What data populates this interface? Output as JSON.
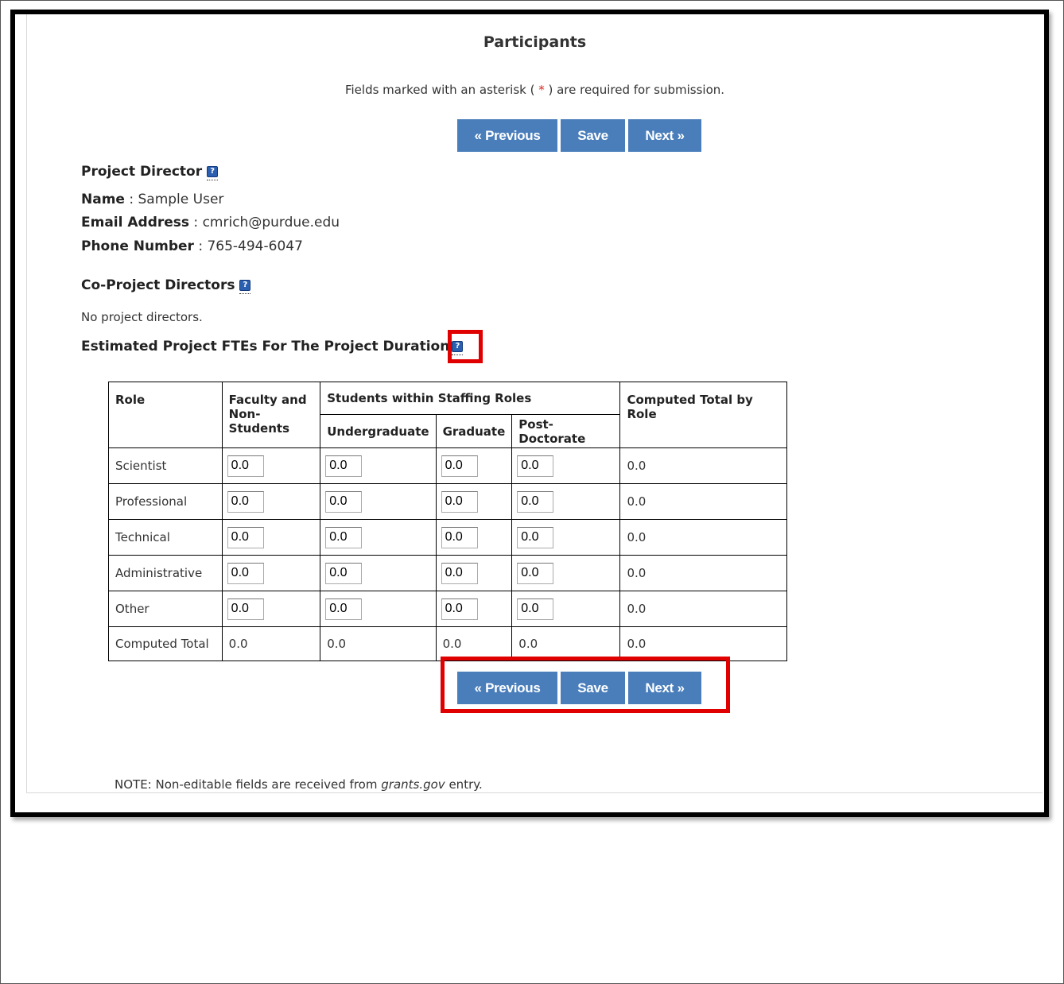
{
  "title": "Participants",
  "required_note": {
    "before": "Fields marked with an asterisk ( ",
    "star": "*",
    "after": " ) are required for submission."
  },
  "nav": {
    "previous": "« Previous",
    "save": "Save",
    "next": "Next »"
  },
  "project_director": {
    "heading": "Project Director",
    "name_label": "Name",
    "name_value": "Sample User",
    "email_label": "Email Address",
    "email_value": "cmrich@purdue.edu",
    "phone_label": "Phone Number",
    "phone_value": "765-494-6047"
  },
  "co_directors": {
    "heading": "Co-Project Directors",
    "empty_text": "No project directors."
  },
  "fte": {
    "heading": "Estimated Project FTEs For The Project Duration",
    "headers": {
      "role": "Role",
      "faculty": "Faculty and Non-Students",
      "students": "Students within Staffing Roles",
      "undergraduate": "Undergraduate",
      "graduate": "Graduate",
      "postdoc": "Post-Doctorate",
      "total_by_role": "Computed Total by Role"
    },
    "rows": [
      {
        "role": "Scientist",
        "values": [
          "0.0",
          "0.0",
          "0.0",
          "0.0"
        ],
        "total": "0.0"
      },
      {
        "role": "Professional",
        "values": [
          "0.0",
          "0.0",
          "0.0",
          "0.0"
        ],
        "total": "0.0"
      },
      {
        "role": "Technical",
        "values": [
          "0.0",
          "0.0",
          "0.0",
          "0.0"
        ],
        "total": "0.0"
      },
      {
        "role": "Administrative",
        "values": [
          "0.0",
          "0.0",
          "0.0",
          "0.0"
        ],
        "total": "0.0"
      },
      {
        "role": "Other",
        "values": [
          "0.0",
          "0.0",
          "0.0",
          "0.0"
        ],
        "total": "0.0"
      }
    ],
    "computed_total": {
      "label": "Computed Total",
      "values": [
        "0.0",
        "0.0",
        "0.0",
        "0.0",
        "0.0"
      ]
    }
  },
  "footer_note": {
    "prefix": "NOTE: Non-editable fields are received from ",
    "source": "grants.gov",
    "suffix": " entry."
  },
  "colors": {
    "button": "#4a7ebb",
    "highlight": "#e00000",
    "required_star": "#d9261c"
  }
}
